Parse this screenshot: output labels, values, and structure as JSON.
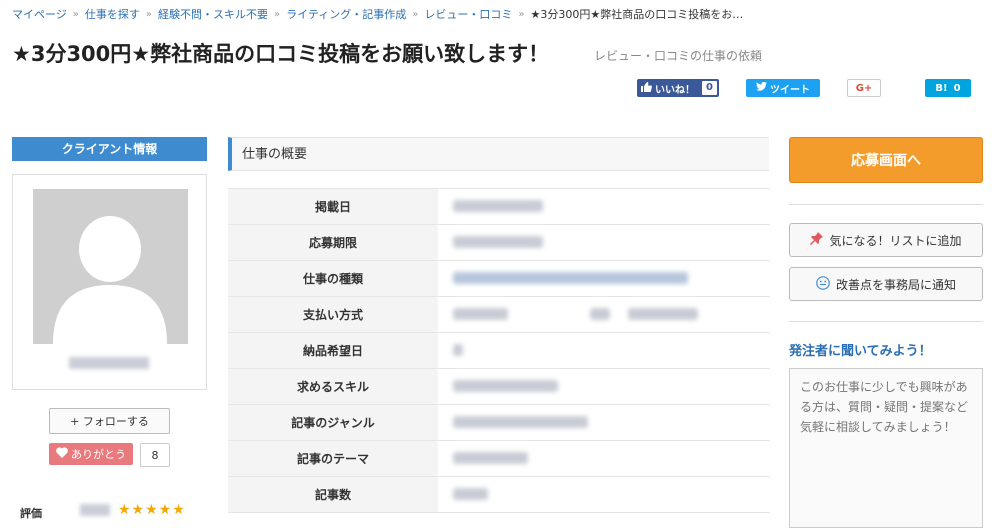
{
  "breadcrumb": [
    "マイページ",
    "仕事を探す",
    "経験不問・スキル不要",
    "ライティング・記事作成",
    "レビュー・口コミ",
    "★3分300円★弊社商品の口コミ投稿をお…"
  ],
  "breadcrumb_separator": "»",
  "page": {
    "title": "★3分300円★弊社商品の口コミ投稿をお願い致します！",
    "subtitle": "レビュー・口コミの仕事の依頼"
  },
  "social": {
    "like_label": "いいね！",
    "like_count": "0",
    "tweet_label": "ツイート",
    "gplus_label": "G+",
    "hatena_label": "B!",
    "hatena_count": "0"
  },
  "client": {
    "header": "クライアント情報",
    "follow_label": "+ フォローする",
    "thanks_label": "ありがとう",
    "thanks_count": "8",
    "rating_label": "評価",
    "rating_stars": "★★★★★"
  },
  "overview": {
    "title": "仕事の概要",
    "rows": [
      {
        "label": "掲載日"
      },
      {
        "label": "応募期限"
      },
      {
        "label": "仕事の種類"
      },
      {
        "label": "支払い方式"
      },
      {
        "label": "納品希望日"
      },
      {
        "label": "求めるスキル"
      },
      {
        "label": "記事のジャンル"
      },
      {
        "label": "記事のテーマ"
      },
      {
        "label": "記事数"
      }
    ]
  },
  "actions": {
    "apply_label": "応募画面へ",
    "watchlist_label": "気になる！リストに追加",
    "report_label": "改善点を事務局に通知",
    "ask_heading": "発注者に聞いてみよう！",
    "question_placeholder": "このお仕事に少しでも興味がある方は、質問・疑問・提案など気軽に相談してみましょう！"
  },
  "colors": {
    "accent": "#3e8ccf",
    "apply": "#f39c2c",
    "link": "#2a6fb5"
  }
}
